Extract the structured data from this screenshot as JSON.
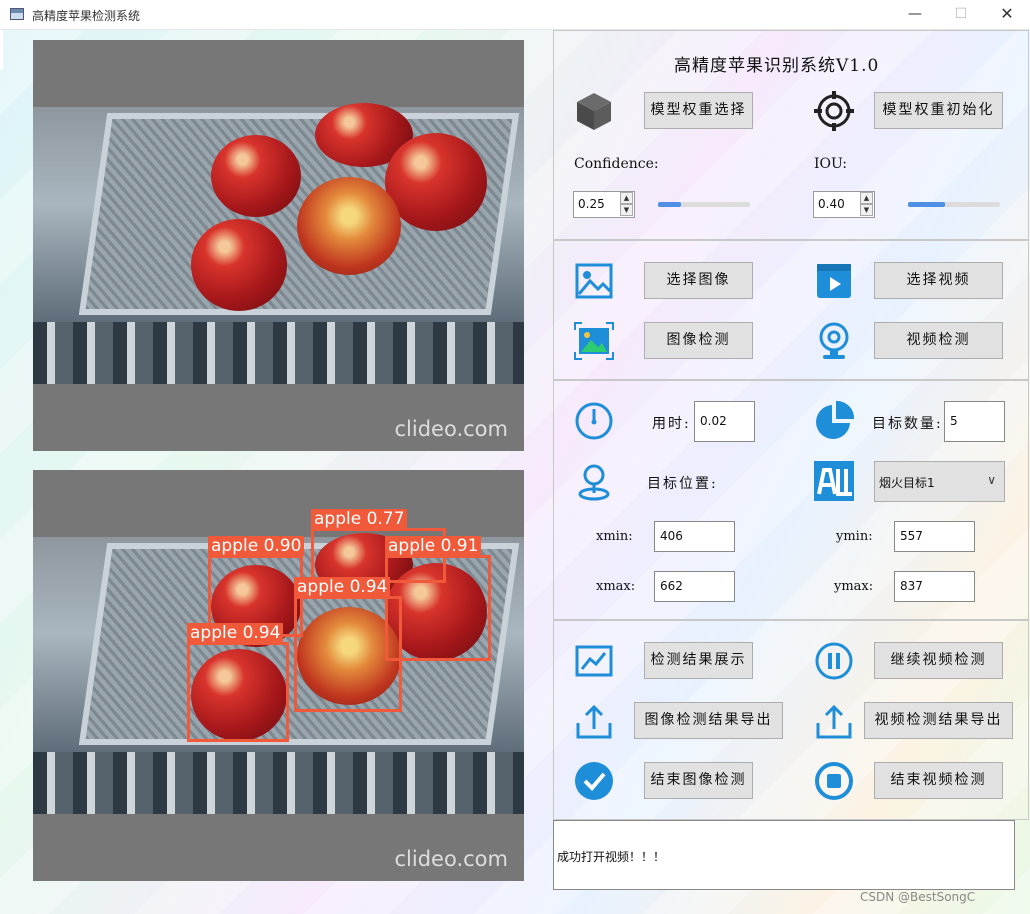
{
  "window": {
    "title": "高精度苹果检测系统",
    "minimize": "—",
    "maximize": "☐",
    "close": "✕"
  },
  "images": {
    "top_watermark": "clideo.com",
    "bottom_watermark": "clideo.com",
    "detections": [
      {
        "label": "apple 0.77"
      },
      {
        "label": "apple 0.90"
      },
      {
        "label": "apple 0.91"
      },
      {
        "label": "apple 0.94"
      },
      {
        "label": "apple 0.94"
      }
    ]
  },
  "header": {
    "title": "高精度苹果识别系统V1.0"
  },
  "model": {
    "select_label": "模型权重选择",
    "init_label": "模型权重初始化"
  },
  "params": {
    "confidence_label": "Confidence:",
    "confidence_value": "0.25",
    "confidence_level": 0.25,
    "iou_label": "IOU:",
    "iou_value": "0.40",
    "iou_level": 0.4
  },
  "actions": {
    "select_image": "选择图像",
    "select_video": "选择视频",
    "detect_image": "图像检测",
    "detect_video": "视频检测"
  },
  "stats": {
    "time_label": "用时:",
    "time_value": "0.02",
    "count_label": "目标数量:",
    "count_value": "5",
    "position_label": "目标位置:",
    "target_selected": "烟火目标1",
    "xmin_label": "xmin:",
    "xmin_value": "406",
    "ymin_label": "ymin:",
    "ymin_value": "557",
    "xmax_label": "xmax:",
    "xmax_value": "662",
    "ymax_label": "ymax:",
    "ymax_value": "837"
  },
  "results": {
    "show": "检测结果展示",
    "continue_video": "继续视频检测",
    "export_image": "图像检测结果导出",
    "export_video": "视频检测结果导出",
    "end_image": "结束图像检测",
    "end_video": "结束视频检测"
  },
  "log": {
    "text": "成功打开视频！！！"
  },
  "footer": {
    "credit": "CSDN @BestSongC"
  },
  "colors": {
    "icon_blue": "#1f8ed8",
    "box_orange": "#f05a3a",
    "slider_fill": "#4f8fe6"
  }
}
